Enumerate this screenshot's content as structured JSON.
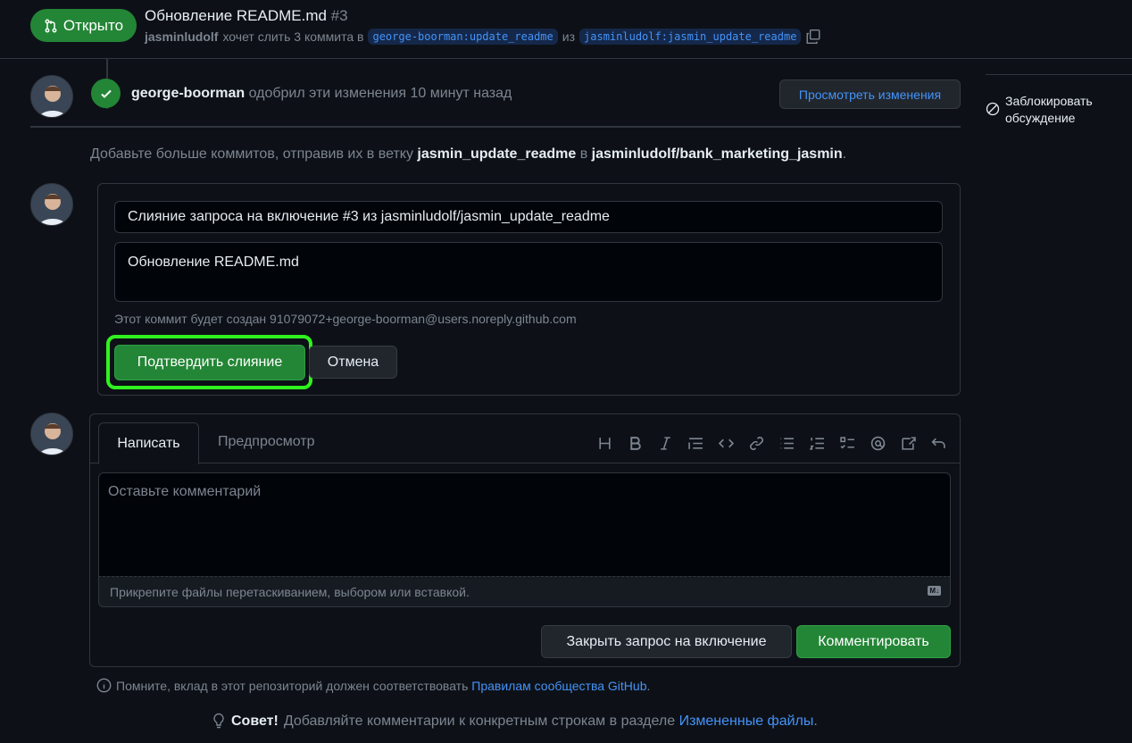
{
  "header": {
    "state": "Открыто",
    "title": "Обновление README.md",
    "number": "#3",
    "author": "jasminludolf",
    "merge_text": "хочет слить 3 коммита в",
    "base_branch": "george-boorman:update_readme",
    "from_word": "из",
    "head_branch": "jasminludolf:jasmin_update_readme"
  },
  "review": {
    "reviewer": "george-boorman",
    "text": "одобрил эти изменения 10 минут назад",
    "view_changes": "Просмотреть изменения"
  },
  "sidebar": {
    "lock_line1": "Заблокировать",
    "lock_line2": "обсуждение"
  },
  "branch_hint": {
    "prefix": "Добавьте больше коммитов, отправив их в ветку",
    "branch": "jasmin_update_readme",
    "in": "в",
    "repo": "jasminludolf/bank_marketing_jasmin",
    "suffix": "."
  },
  "merge": {
    "title_value": "Слияние запроса на включение #3 из jasminludolf/jasmin_update_readme",
    "body_value": "Обновление README.md",
    "commit_note": "Этот коммит будет создан 91079072+george-boorman@users.noreply.github.com",
    "confirm": "Подтвердить слияние",
    "cancel": "Отмена"
  },
  "comment": {
    "tab_write": "Написать",
    "tab_preview": "Предпросмотр",
    "placeholder": "Оставьте комментарий",
    "attach": "Прикрепите файлы перетаскиванием, выбором или вставкой.",
    "md_badge": "M↓",
    "close_pr": "Закрыть запрос на включение",
    "submit": "Комментировать",
    "toolbar": [
      "heading-icon",
      "bold-icon",
      "italic-icon",
      "quote-icon",
      "code-icon",
      "link-icon",
      "unordered-list-icon",
      "ordered-list-icon",
      "task-list-icon",
      "mention-icon",
      "reference-icon",
      "undo-icon"
    ]
  },
  "footer": {
    "guidelines_text": "Помните, вклад в этот репозиторий должен соответствовать",
    "guidelines_link": "Правилам сообщества GitHub",
    "guidelines_end": ".",
    "protip_label": "Совет!",
    "protip_text": "Добавляйте комментарии к конкретным строкам в разделе",
    "protip_link": "Измененные файлы",
    "protip_end": "."
  },
  "colors": {
    "background": "#0d1117",
    "accent_green": "#238636",
    "link_blue": "#4493f8",
    "highlight": "#2ff21f"
  }
}
